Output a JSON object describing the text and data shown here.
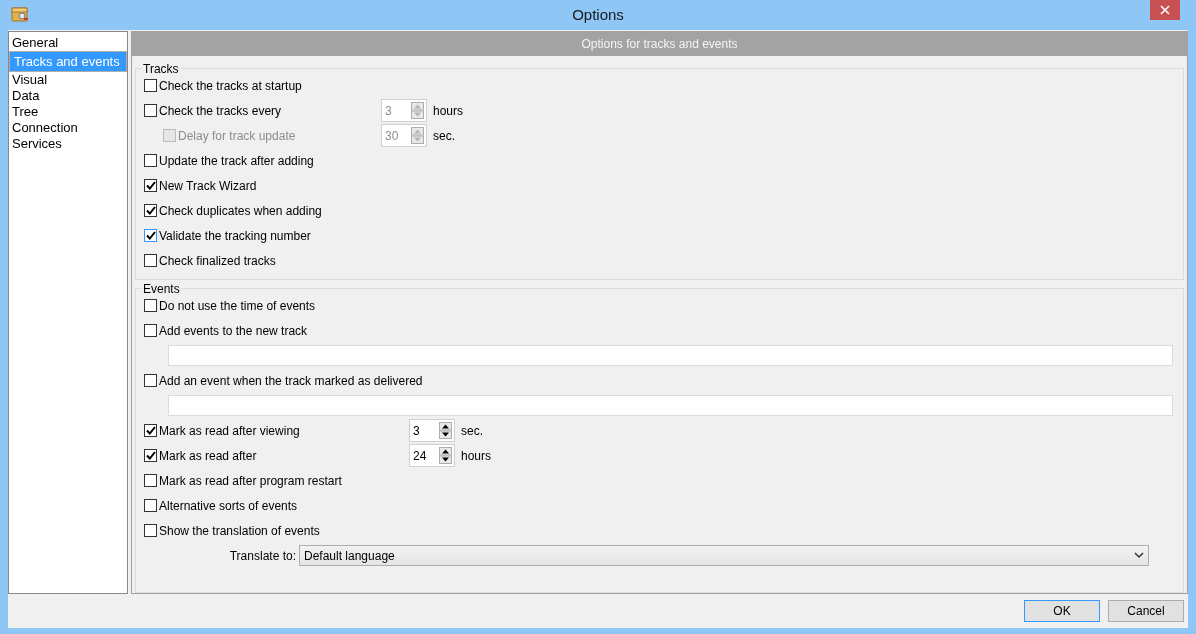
{
  "window": {
    "title": "Options"
  },
  "sidebar": {
    "items": [
      {
        "label": "General",
        "selected": false
      },
      {
        "label": "Tracks and events",
        "selected": true
      },
      {
        "label": "Visual",
        "selected": false
      },
      {
        "label": "Data",
        "selected": false
      },
      {
        "label": "Tree",
        "selected": false
      },
      {
        "label": "Connection",
        "selected": false
      },
      {
        "label": "Services",
        "selected": false
      }
    ]
  },
  "header": "Options for tracks and events",
  "groups": [
    {
      "title": "Tracks",
      "rows": [
        {
          "kind": "checkbox",
          "label": "Check the tracks at startup",
          "checked": false,
          "disabled": false,
          "focused": false
        },
        {
          "kind": "checkbox",
          "label": "Check the tracks every",
          "checked": false,
          "disabled": false,
          "focused": false,
          "spinner": {
            "value": "3",
            "unit": "hours",
            "disabled": true
          },
          "children": [
            {
              "kind": "checkbox",
              "label": "Delay for track update",
              "checked": false,
              "disabled": true,
              "focused": false,
              "spinner": {
                "value": "30",
                "unit": "sec.",
                "disabled": true
              }
            }
          ]
        },
        {
          "kind": "checkbox",
          "label": "Update the track after adding",
          "checked": false,
          "disabled": false,
          "focused": false
        },
        {
          "kind": "checkbox",
          "label": "New Track Wizard",
          "checked": true,
          "disabled": false,
          "focused": false
        },
        {
          "kind": "checkbox",
          "label": "Check duplicates when adding",
          "checked": true,
          "disabled": false,
          "focused": false
        },
        {
          "kind": "checkbox",
          "label": "Validate the tracking number",
          "checked": true,
          "disabled": false,
          "focused": true
        },
        {
          "kind": "checkbox",
          "label": "Check finalized tracks",
          "checked": false,
          "disabled": false,
          "focused": false
        }
      ]
    },
    {
      "title": "Events",
      "rows": [
        {
          "kind": "checkbox",
          "label": "Do not use the time of events",
          "checked": false,
          "disabled": false,
          "focused": false
        },
        {
          "kind": "checkbox",
          "label": "Add events to the new track",
          "checked": false,
          "disabled": false,
          "focused": false
        },
        {
          "kind": "field"
        },
        {
          "kind": "checkbox",
          "label": "Add an event when the track marked as delivered",
          "checked": false,
          "disabled": false,
          "focused": false
        },
        {
          "kind": "field"
        },
        {
          "kind": "checkbox",
          "label": "Mark as read after viewing",
          "checked": true,
          "disabled": false,
          "focused": false,
          "spinner": {
            "value": "3",
            "unit": "sec.",
            "disabled": false
          }
        },
        {
          "kind": "checkbox",
          "label": "Mark as read after",
          "checked": true,
          "disabled": false,
          "focused": false,
          "spinner": {
            "value": "24",
            "unit": "hours",
            "disabled": false
          }
        },
        {
          "kind": "checkbox",
          "label": "Mark as read after program restart",
          "checked": false,
          "disabled": false,
          "focused": false
        },
        {
          "kind": "checkbox",
          "label": "Alternative sorts of events",
          "checked": false,
          "disabled": false,
          "focused": false
        },
        {
          "kind": "checkbox",
          "label": "Show the translation of events",
          "checked": false,
          "disabled": false,
          "focused": false
        },
        {
          "kind": "select",
          "label": "Translate to:",
          "value": "Default language"
        }
      ]
    }
  ],
  "buttons": [
    {
      "label": "OK",
      "default": true
    },
    {
      "label": "Cancel",
      "default": false
    }
  ]
}
